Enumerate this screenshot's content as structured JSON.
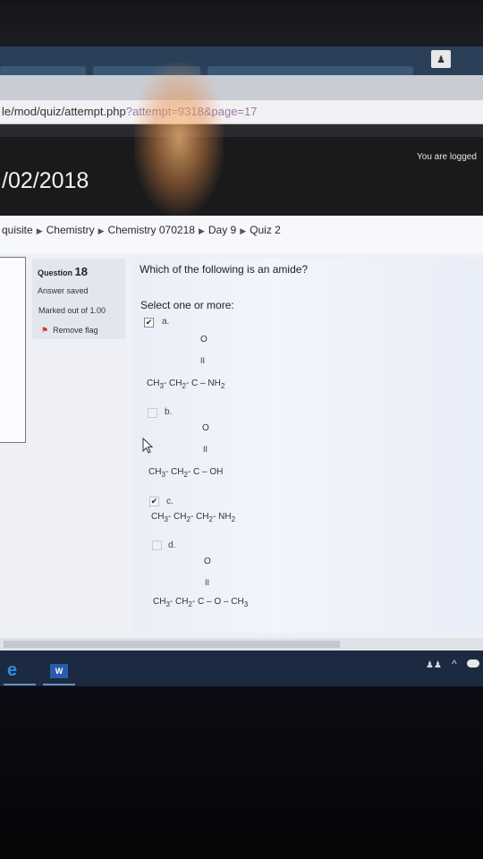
{
  "browser": {
    "url_path": "le/mod/quiz/attempt.php",
    "url_query": "?attempt=9318&page=17",
    "user_icon": "person-icon"
  },
  "header": {
    "login_info": "You are logged",
    "date": "/02/2018"
  },
  "breadcrumb": [
    "quisite",
    "Chemistry",
    "Chemistry 070218",
    "Day 9",
    "Quiz 2"
  ],
  "question_info": {
    "label": "Question",
    "number": "18",
    "status": "Answer saved",
    "marks": "Marked out of 1.00",
    "flag_label": "Remove flag"
  },
  "question": {
    "text": "Which of the following is an amide?",
    "prompt": "Select one or more:",
    "options": [
      {
        "letter": "a.",
        "checked": true,
        "top": "O",
        "bond": "II",
        "formula": "CH3- CH2- C – NH2"
      },
      {
        "letter": "b.",
        "checked": false,
        "top": "O",
        "bond": "II",
        "formula": "CH3- CH2- C – OH"
      },
      {
        "letter": "c.",
        "checked": true,
        "formula": "CH3- CH2- CH2- NH2"
      },
      {
        "letter": "d.",
        "checked": false,
        "top": "O",
        "bond": "II",
        "formula": "CH3- CH2- C – O – CH3"
      }
    ]
  },
  "taskbar": {
    "edge_icon": "edge-browser-icon",
    "word_label": "W",
    "people_icon": "people-icon",
    "chevron": "^"
  }
}
